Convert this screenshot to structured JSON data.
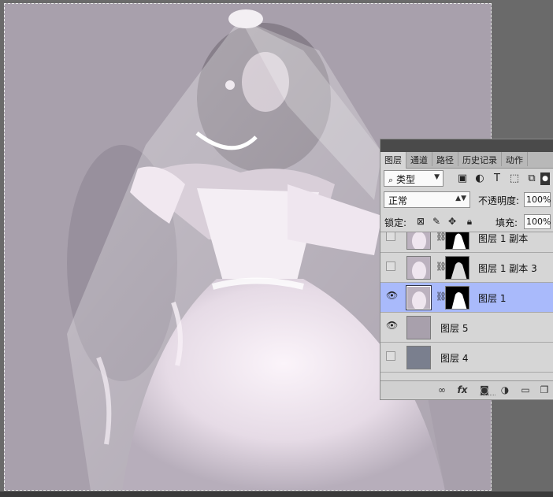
{
  "panel": {
    "tabs": [
      {
        "label": "图层",
        "active": true
      },
      {
        "label": "通道",
        "active": false
      },
      {
        "label": "路径",
        "active": false
      },
      {
        "label": "历史记录",
        "active": false
      },
      {
        "label": "动作",
        "active": false
      }
    ],
    "filter": {
      "icon": "search-icon",
      "label": "类型"
    },
    "filter_icons": [
      "image-filter-icon",
      "adjustment-filter-icon",
      "type-filter-icon",
      "shape-filter-icon",
      "smart-object-filter-icon"
    ],
    "blend_mode": "正常",
    "opacity_label": "不透明度:",
    "opacity_value": "100%",
    "lock_label": "锁定:",
    "lock_icons": [
      "lock-transparent-icon",
      "lock-paint-icon",
      "lock-move-icon",
      "lock-all-icon"
    ],
    "fill_label": "填充:",
    "fill_value": "100%",
    "layers": [
      {
        "name": "图层 1 副本",
        "visible": false,
        "selected": false,
        "has_mask": true
      },
      {
        "name": "图层 1 副本 3",
        "visible": false,
        "selected": false,
        "has_mask": true
      },
      {
        "name": "图层 1",
        "visible": true,
        "selected": true,
        "has_mask": true
      },
      {
        "name": "图层 5",
        "visible": true,
        "selected": false,
        "has_mask": false,
        "fill_color": "#a8a0ac"
      },
      {
        "name": "图层 4",
        "visible": false,
        "selected": false,
        "has_mask": false,
        "fill_color": "#7a7f8e"
      }
    ],
    "bottom_icons": [
      "link-layers-icon",
      "fx-icon",
      "add-mask-icon",
      "adjustment-layer-icon",
      "group-folder-icon",
      "new-layer-icon"
    ],
    "fx_label": "fx"
  },
  "colors": {
    "canvas_bg": "#a8a0ac",
    "selected_layer": "#a9bafb",
    "workspace": "#6a6a6a"
  }
}
